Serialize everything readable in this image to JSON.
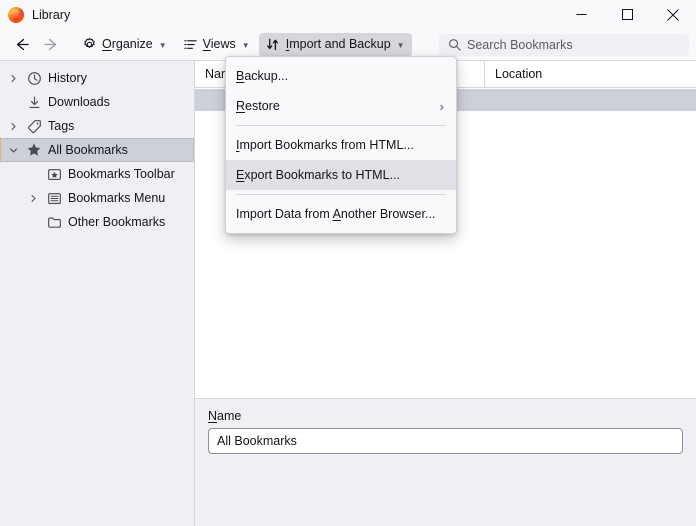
{
  "window": {
    "title": "Library",
    "app_icon": "firefox-logo-icon",
    "controls": {
      "minimize": "minimize-icon",
      "maximize": "maximize-icon",
      "close": "close-icon"
    }
  },
  "toolbar": {
    "back": "back-arrow-icon",
    "forward": "forward-arrow-icon",
    "organize": {
      "label": "Organize",
      "accesskey": "O",
      "icon": "gear-icon"
    },
    "views": {
      "label": "Views",
      "accesskey": "V",
      "icon": "list-view-icon"
    },
    "import_backup": {
      "label": "Import and Backup",
      "accesskey": "I",
      "icon": "import-export-arrows-icon",
      "state": "active"
    },
    "search": {
      "placeholder": "Search Bookmarks",
      "value": "",
      "icon": "search-icon"
    }
  },
  "menu": {
    "items": [
      {
        "label": "Backup...",
        "accesskey": "B",
        "type": "item",
        "highlighted": false,
        "submenu": false
      },
      {
        "label": "Restore",
        "accesskey": "R",
        "type": "item",
        "highlighted": false,
        "submenu": true,
        "arrow": "›"
      },
      {
        "type": "separator"
      },
      {
        "label": "Import Bookmarks from HTML...",
        "accesskey": "I",
        "type": "item",
        "highlighted": false,
        "submenu": false
      },
      {
        "label": "Export Bookmarks to HTML...",
        "accesskey": "E",
        "type": "item",
        "highlighted": true,
        "submenu": false
      },
      {
        "type": "separator"
      },
      {
        "label": "Import Data from Another Browser...",
        "accesskey": "A",
        "type": "item",
        "highlighted": false,
        "submenu": false
      }
    ]
  },
  "sidebar": {
    "items": [
      {
        "label": "History",
        "icon": "clock-icon",
        "twisty": "collapsed",
        "indent": 0,
        "selected": false
      },
      {
        "label": "Downloads",
        "icon": "download-icon",
        "twisty": "none",
        "indent": 0,
        "selected": false
      },
      {
        "label": "Tags",
        "icon": "tag-icon",
        "twisty": "collapsed",
        "indent": 0,
        "selected": false
      },
      {
        "label": "All Bookmarks",
        "icon": "star-icon",
        "twisty": "expanded",
        "indent": 0,
        "selected": true
      },
      {
        "label": "Bookmarks Toolbar",
        "icon": "bookmarks-toolbar-icon",
        "twisty": "none",
        "indent": 1,
        "selected": false
      },
      {
        "label": "Bookmarks Menu",
        "icon": "bookmarks-menu-icon",
        "twisty": "collapsed",
        "indent": 1,
        "selected": false
      },
      {
        "label": "Other Bookmarks",
        "icon": "folder-icon",
        "twisty": "none",
        "indent": 1,
        "selected": false
      }
    ]
  },
  "list": {
    "columns": [
      {
        "label": "Name"
      },
      {
        "label": "Location"
      }
    ],
    "rows": [
      {
        "name": "",
        "location": "",
        "selected": true
      }
    ]
  },
  "detail": {
    "name_label": "Name",
    "name_accesskey": "N",
    "name_value": "All Bookmarks"
  },
  "colors": {
    "chrome_bg": "#f9f9fb",
    "sidebar_bg": "#f0f0f4",
    "selection": "#cdd0d9",
    "menu_hover": "#e0e0e6",
    "border": "#d7d7db",
    "text": "#15141a"
  }
}
